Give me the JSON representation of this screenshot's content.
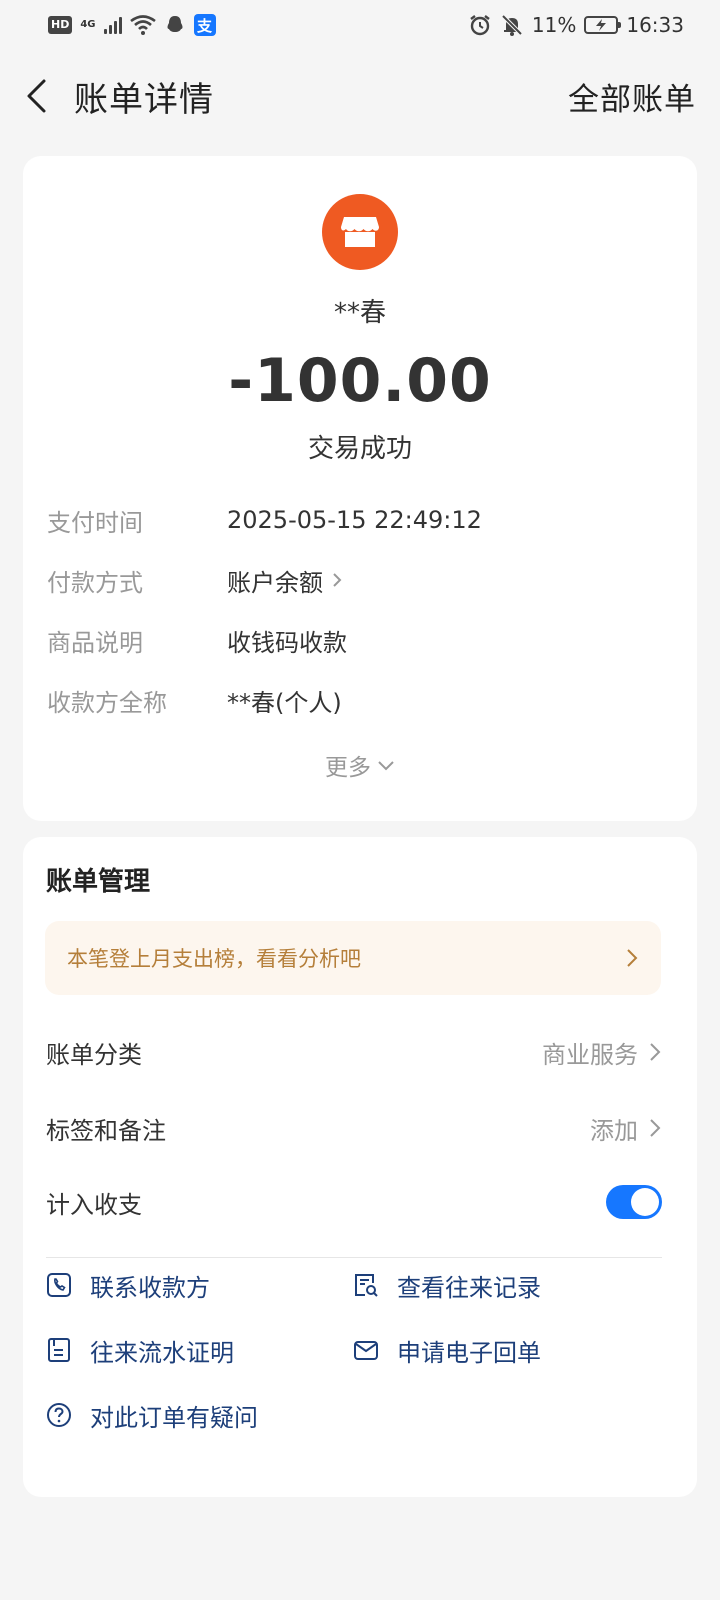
{
  "status_bar": {
    "hd": "HD",
    "network": "4G",
    "battery": "11%",
    "time": "16:33"
  },
  "header": {
    "title": "账单详情",
    "all_bills": "全部账单"
  },
  "bill": {
    "merchant_name": "**春",
    "amount": "-100.00",
    "status": "交易成功",
    "details": [
      {
        "label": "支付时间",
        "value": "2025-05-15 22:49:12"
      },
      {
        "label": "付款方式",
        "value": "账户余额"
      },
      {
        "label": "商品说明",
        "value": "收钱码收款"
      },
      {
        "label": "收款方全称",
        "value": "**春(个人)"
      }
    ],
    "more": "更多"
  },
  "manage": {
    "title": "账单管理",
    "promo": "本笔登上月支出榜，看看分析吧",
    "rows": [
      {
        "label": "账单分类",
        "value": "商业服务"
      },
      {
        "label": "标签和备注",
        "value": "添加"
      },
      {
        "label": "计入收支",
        "value": ""
      }
    ],
    "actions": [
      {
        "label": "联系收款方",
        "icon": "phone-icon"
      },
      {
        "label": "查看往来记录",
        "icon": "record-search-icon"
      },
      {
        "label": "往来流水证明",
        "icon": "document-icon"
      },
      {
        "label": "申请电子回单",
        "icon": "mail-icon"
      },
      {
        "label": "对此订单有疑问",
        "icon": "question-icon"
      }
    ]
  },
  "colors": {
    "accent": "#1677ff",
    "merchant_logo": "#ef5a22",
    "promo_text": "#b57f3a",
    "action_text": "#1d3f7a"
  }
}
